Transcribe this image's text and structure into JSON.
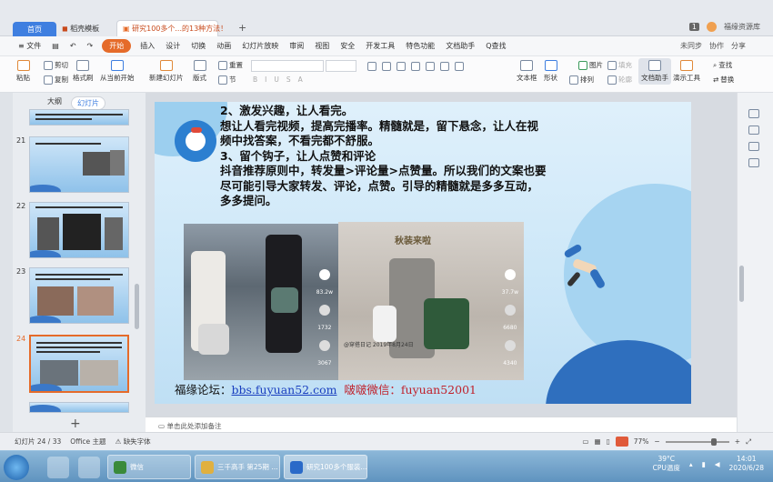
{
  "tabs": {
    "home": "首页",
    "template": "稻壳模板",
    "doc": "研究100多个...的13种方法！"
  },
  "titlebar": {
    "badge": "1",
    "user": "福缘资源库"
  },
  "menu": {
    "file": "≡ 文件",
    "start": "开始",
    "items": [
      "插入",
      "设计",
      "切换",
      "动画",
      "幻灯片放映",
      "审阅",
      "视图",
      "安全",
      "开发工具",
      "特色功能",
      "文档助手"
    ],
    "search": "Q查找",
    "sync": "未同步",
    "collab": "协作",
    "share": "分享"
  },
  "ribbon": {
    "paste": "粘贴",
    "cut": "剪切",
    "copy": "复制",
    "format": "格式刷",
    "fromstart": "从当前开始",
    "newslide": "新建幻灯片",
    "layout": "版式",
    "reset": "重置",
    "section": "节",
    "textbox": "文本框",
    "shape": "形状",
    "arrange": "排列",
    "picture": "图片",
    "fill": "填充",
    "outline": "轮廓",
    "docassist": "文档助手",
    "presenttools": "演示工具",
    "find": "查找",
    "replace": "替换"
  },
  "leftpanel": {
    "outline_tab": "大纲",
    "slides_tab": "幻灯片",
    "slide_numbers": [
      "21",
      "22",
      "23",
      "24"
    ]
  },
  "slide": {
    "lines": [
      "2、激发兴趣，让人看完。",
      "想让人看完视频，提高完播率。精髓就是，留下悬念，让人在视",
      "频中找答案，不看完都不舒服。",
      "3、留个钩子，让人点赞和评论",
      "抖音推荐原则中，转发量>评论量>点赞量。所以我们的文案也要",
      "尽可能引导大家转发、评论，点赞。引导的精髓就是多多互动，",
      "多多提问。"
    ],
    "photo2_title": "秋装来啦",
    "photo1_stats": [
      "83.2w",
      "1732",
      "3067"
    ],
    "photo2_stats": [
      "37.7w",
      "6680",
      "4340"
    ],
    "photo2_caption": "@穿搭日记  2019年8月24日",
    "footer_a": "福缘论坛：",
    "footer_b": "bbs.fuyuan52.com",
    "footer_c": "啵啵微信：fuyuan52001"
  },
  "notes": {
    "placeholder": "单击此处添加备注"
  },
  "status": {
    "slide": "幻灯片 24 / 33",
    "theme": "Office 主题",
    "missing_font": "缺失字体",
    "zoom": "77%"
  },
  "taskbar": {
    "wechat": "微信",
    "explorer": "三千高手 第25期 ...",
    "wps": "研究100多个服装...",
    "temp": "39°C",
    "cpu": "CPU温度",
    "time": "14:01",
    "date": "2020/6/28"
  }
}
